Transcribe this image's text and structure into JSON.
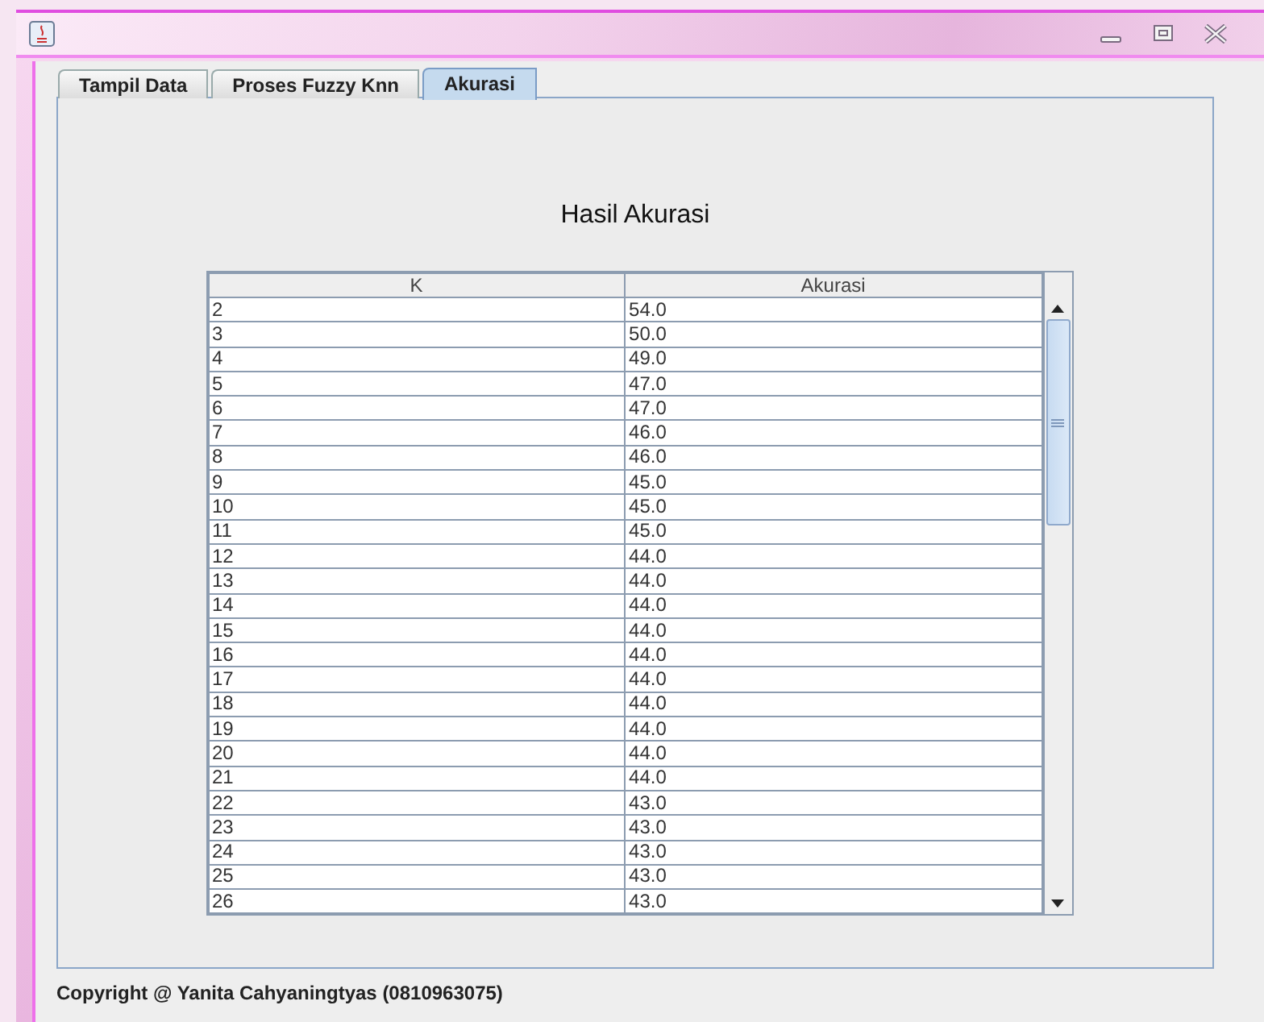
{
  "tabs": [
    {
      "label": "Tampil Data",
      "selected": false
    },
    {
      "label": "Proses Fuzzy Knn",
      "selected": false
    },
    {
      "label": "Akurasi",
      "selected": true
    }
  ],
  "heading": "Hasil Akurasi",
  "table": {
    "columns": [
      "K",
      "Akurasi"
    ],
    "rows": [
      [
        "2",
        "54.0"
      ],
      [
        "3",
        "50.0"
      ],
      [
        "4",
        "49.0"
      ],
      [
        "5",
        "47.0"
      ],
      [
        "6",
        "47.0"
      ],
      [
        "7",
        "46.0"
      ],
      [
        "8",
        "46.0"
      ],
      [
        "9",
        "45.0"
      ],
      [
        "10",
        "45.0"
      ],
      [
        "11",
        "45.0"
      ],
      [
        "12",
        "44.0"
      ],
      [
        "13",
        "44.0"
      ],
      [
        "14",
        "44.0"
      ],
      [
        "15",
        "44.0"
      ],
      [
        "16",
        "44.0"
      ],
      [
        "17",
        "44.0"
      ],
      [
        "18",
        "44.0"
      ],
      [
        "19",
        "44.0"
      ],
      [
        "20",
        "44.0"
      ],
      [
        "21",
        "44.0"
      ],
      [
        "22",
        "43.0"
      ],
      [
        "23",
        "43.0"
      ],
      [
        "24",
        "43.0"
      ],
      [
        "25",
        "43.0"
      ],
      [
        "26",
        "43.0"
      ]
    ]
  },
  "footer": "Copyright @ Yanita Cahyaningtyas (0810963075)"
}
